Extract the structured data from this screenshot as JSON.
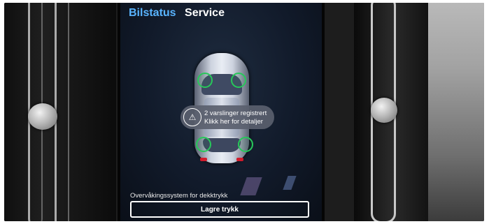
{
  "screen": {
    "tabs": [
      {
        "label": "Bilstatus",
        "active": true
      },
      {
        "label": "Service",
        "active": false
      }
    ],
    "alert": {
      "icon": "warning-triangle-icon",
      "line1": "2 varslinger registrert",
      "line2": "Klikk her for detaljer"
    },
    "tire_status_color": "#27c85a",
    "monitoring_label": "Overvåkingssystem for dekktrykk",
    "save_button_label": "Lagre trykk"
  }
}
